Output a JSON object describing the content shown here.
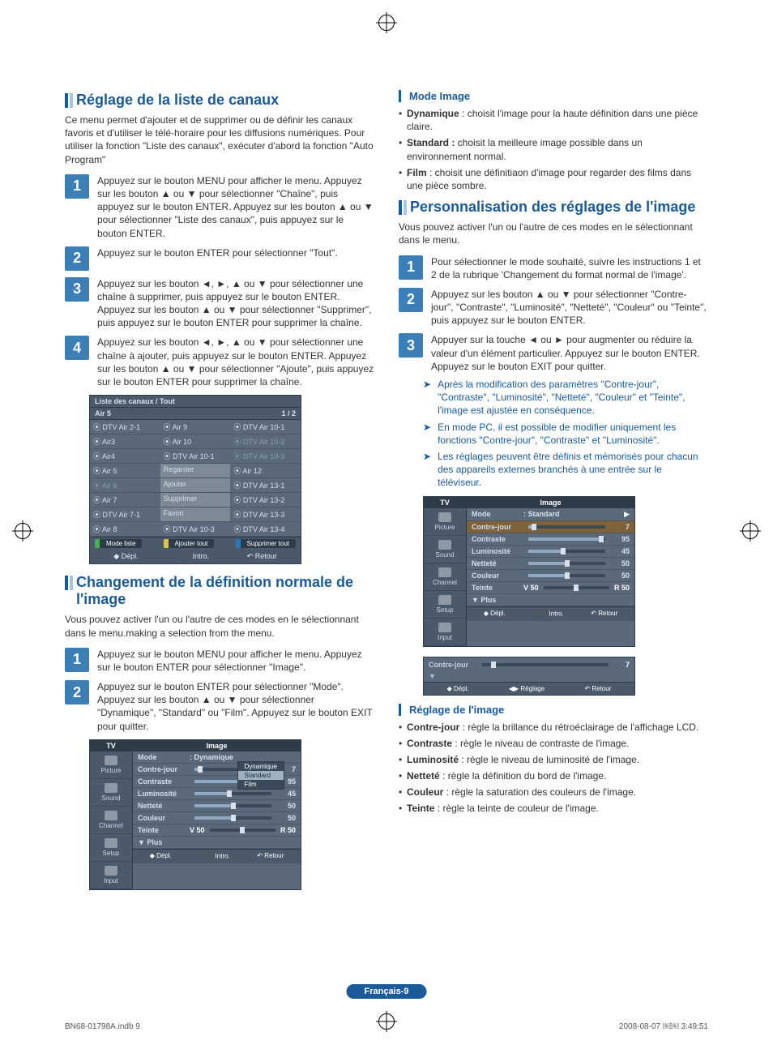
{
  "left": {
    "h1a": "Réglage de la liste de canaux",
    "intro_a": "Ce menu permet d'ajouter et de supprimer ou de définir les canaux favoris et d'utiliser le télé-horaire pour les diffusions numériques. Pour utiliser la fonction \"Liste des canaux\", exécuter d'abord la fonction \"Auto Program\"",
    "s1": "Appuyez sur le bouton MENU pour afficher le menu. Appuyez sur les bouton ▲ ou ▼ pour sélectionner \"Chaîne\", puis appuyez sur le bouton ENTER. Appuyez sur les bouton ▲ ou ▼ pour sélectionner \"Liste des canaux\", puis appuyez sur le bouton ENTER.",
    "s2": "Appuyez sur le bouton ENTER pour sélectionner \"Tout\".",
    "s3": "Appuyez sur les bouton ◄, ►, ▲ ou ▼ pour sélectionner une chaîne à supprimer, puis appuyez sur le bouton ENTER. Appuyez sur les bouton ▲ ou ▼ pour sélectionner \"Supprimer\", puis appuyez sur le bouton ENTER pour supprimer la chaîne.",
    "s4": "Appuyez sur les bouton ◄, ►, ▲ ou ▼ pour sélectionner une chaîne à ajouter, puis appuyez sur le bouton ENTER. Appuyez sur les bouton ▲ ou ▼ pour sélectionner \"Ajoute\", puis appuyez sur le bouton ENTER pour supprimer la chaîne.",
    "osd": {
      "title": "Liste des canaux / Tout",
      "sub_l": "Air 5",
      "sub_r": "1 / 2",
      "col1": [
        "DTV Air 2-1",
        "Air3",
        "Air4",
        "Air 5",
        "Air 6",
        "Air 7",
        "DTV Air 7-1",
        "Air 8"
      ],
      "col2": [
        "Air 9",
        "Air 10",
        "DTV Air 10-1",
        "Regarder",
        "Ajouter",
        "Supprimer",
        "Favori",
        "DTV Air 10-3"
      ],
      "col3": [
        "DTV Air 10-1",
        "DTV Air 10-2",
        "DTV Air 10-3",
        "Air 12",
        "DTV Air 13-1",
        "DTV Air 13-2",
        "DTV Air 13-3",
        "DTV Air 13-4"
      ],
      "btns": [
        "Mode liste",
        "Ajouter tout",
        "Supprimer tout"
      ],
      "foot": [
        "Dépl.",
        "Intro.",
        "Retour"
      ]
    },
    "h1b": "Changement de la définition normale de l'image",
    "intro_b": "Vous pouvez activer l'un ou l'autre de ces modes en le sélectionnant dans le menu.making a selection from the menu.",
    "b1": "Appuyez sur le bouton MENU pour afficher le menu. Appuyez sur le bouton ENTER pour sélectionner \"Image\".",
    "b2": "Appuyez sur le bouton ENTER pour sélectionner \"Mode\". Appuyez sur les bouton ▲ ou ▼ pour sélectionner \"Dynamique\", \"Standard\" ou \"Film\". Appuyez sur le bouton EXIT pour quitter.",
    "tv": {
      "tv": "TV",
      "title": "Image",
      "side": [
        "Picture",
        "Sound",
        "Channel",
        "Setup",
        "Input"
      ],
      "modeLabel": "Mode",
      "modeValue": "Dynamique",
      "dd": [
        "Dynamique",
        "Standard",
        "Film"
      ],
      "rows": [
        {
          "lab": "Contre-jour",
          "val": "7",
          "pct": 7
        },
        {
          "lab": "Contraste",
          "val": "95",
          "pct": 95
        },
        {
          "lab": "Luminosité",
          "val": "45",
          "pct": 45
        },
        {
          "lab": "Netteté",
          "val": "50",
          "pct": 50
        },
        {
          "lab": "Couleur",
          "val": "50",
          "pct": 50
        }
      ],
      "teinte": {
        "lab": "Teinte",
        "l": "V 50",
        "r": "R 50"
      },
      "plus": "▼ Plus",
      "foot": [
        "Dépl.",
        "Intro.",
        "Retour"
      ]
    }
  },
  "right": {
    "h3a": "Mode Image",
    "modes": [
      {
        "b": "Dynamique",
        "t": ": choisit l'image pour la haute définition dans une pièce claire."
      },
      {
        "b": "Standard :",
        "t": "choisit la meilleure image possible dans un environnement normal."
      },
      {
        "b": "Film",
        "t": ": choisit une définitiaon d'image pour regarder des films dans une pièce sombre."
      }
    ],
    "h1": "Personnalisation des réglages de l'image",
    "intro": "Vous pouvez activer l'un ou l'autre de ces modes en le sélectionnant dans le menu.",
    "s1": "Pour sélectionner le mode souhaité, suivre les instructions 1 et 2 de la rubrique 'Changement du format normal de l'image'.",
    "s2": "Appuyez sur les bouton ▲ ou ▼ pour sélectionner \"Contre-jour\", \"Contraste\", \"Luminosité\", \"Netteté\", \"Couleur\" ou \"Teinte\", puis appuyez sur le bouton ENTER.",
    "s3": "Appuyer sur la touche ◄ ou ► pour augmenter ou réduire la valeur d'un élément particulier. Appuyez sur le bouton ENTER. Appuyez sur le bouton EXIT pour quitter.",
    "notes": [
      "Après la modification des paramètres \"Contre-jour\", \"Contraste\", \"Luminosité\", \"Netteté\", \"Couleur\" et \"Teinte\", l'image est ajustée en conséquence.",
      "En mode PC, il est possible de modifier uniquement les fonctions \"Contre-jour\", \"Contraste\" et \"Luminosité\".",
      "Les réglages peuvent être définis et mémorisés pour chacun des appareils externes branchés à une entrée sur le téléviseur."
    ],
    "tv": {
      "tv": "TV",
      "title": "Image",
      "side": [
        "Picture",
        "Sound",
        "Channel",
        "Setup",
        "Input"
      ],
      "modeLabel": "Mode",
      "modeValue": ": Standard",
      "rows": [
        {
          "lab": "Contre-jour",
          "val": "7",
          "pct": 7
        },
        {
          "lab": "Contraste",
          "val": "95",
          "pct": 95
        },
        {
          "lab": "Luminosité",
          "val": "45",
          "pct": 45
        },
        {
          "lab": "Netteté",
          "val": "50",
          "pct": 50
        },
        {
          "lab": "Couleur",
          "val": "50",
          "pct": 50
        }
      ],
      "teinte": {
        "lab": "Teinte",
        "l": "V 50",
        "r": "R 50"
      },
      "plus": "▼ Plus",
      "foot": [
        "Dépl.",
        "Intro.",
        "Retour"
      ]
    },
    "slbar": {
      "lab": "Contre-jour",
      "val": "7",
      "foot": [
        "Dépl.",
        "Réglage",
        "Retour"
      ]
    },
    "h3b": "Réglage de l'image",
    "defs": [
      {
        "b": "Contre-jour",
        "t": ": règle la brillance du rétroéclairage de l'affichage LCD."
      },
      {
        "b": "Contraste",
        "t": ": règle le niveau de contraste de l'image."
      },
      {
        "b": "Luminosité",
        "t": ": règle le niveau de luminosité de l'image."
      },
      {
        "b": "Netteté",
        "t": ": règle la définition du bord de l'image."
      },
      {
        "b": "Couleur",
        "t": ": règle la saturation des couleurs de l'image."
      },
      {
        "b": "Teinte",
        "t": ": règle la teinte de couleur de l'image."
      }
    ]
  },
  "pagefoot": "Français-9",
  "meta_l": "BN68-01798A.indb   9",
  "meta_r": "2008-08-07   ￼￼ 3:49:51"
}
